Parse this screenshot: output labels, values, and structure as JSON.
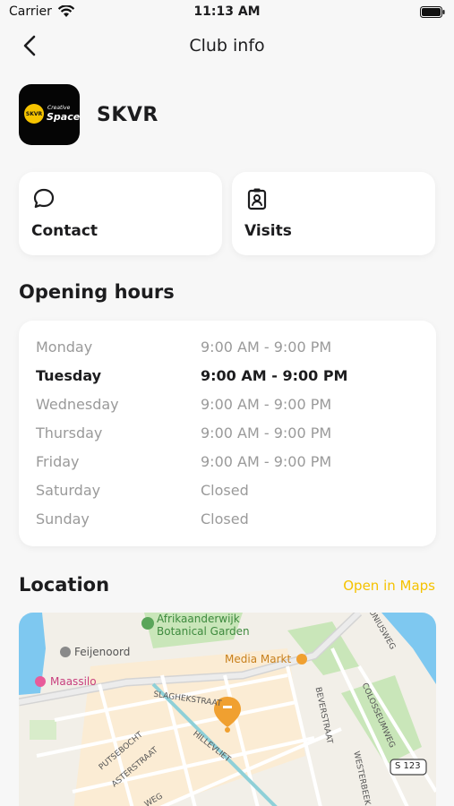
{
  "status": {
    "carrier": "Carrier",
    "time": "11:13 AM"
  },
  "nav": {
    "title": "Club info"
  },
  "club": {
    "name": "SKVR",
    "logo_badge": "SKVR",
    "logo_small": "Creative",
    "logo_word": "Space"
  },
  "actions": [
    {
      "label": "Contact",
      "icon": "chat-bubble-icon"
    },
    {
      "label": "Visits",
      "icon": "id-badge-icon"
    }
  ],
  "hours": {
    "title": "Opening hours",
    "rows": [
      {
        "day": "Monday",
        "time": "9:00 AM - 9:00 PM"
      },
      {
        "day": "Tuesday",
        "time": "9:00 AM - 9:00 PM"
      },
      {
        "day": "Wednesday",
        "time": "9:00 AM - 9:00 PM"
      },
      {
        "day": "Thursday",
        "time": "9:00 AM - 9:00 PM"
      },
      {
        "day": "Friday",
        "time": "9:00 AM - 9:00 PM"
      },
      {
        "day": "Saturday",
        "time": "Closed"
      },
      {
        "day": "Sunday",
        "time": "Closed"
      }
    ],
    "today": "Tuesday"
  },
  "location": {
    "title": "Location",
    "open_maps": "Open in Maps",
    "map_labels": {
      "garden_1": "Afrikaanderwijk",
      "garden_2": "Botanical Garden",
      "feijenoord": "Feijenoord",
      "media_markt": "Media Markt",
      "maassilo": "Maassilo",
      "slaghek": "SLAGHEKSTRAAT",
      "putsebocht": "PUTSEBOCHT",
      "asterstraat": "ASTERSTRAAT",
      "hillevliet": "HILLEVLIET",
      "beverstraat": "BEVERSTRAAT",
      "colosseumweg": "COLOSSEUMWEG",
      "westerbeek": "WESTERBEEK",
      "oniusweg": "ONIUSWEG",
      "route": "S 123",
      "weg": "WEG"
    }
  },
  "colors": {
    "accent": "#f5c200",
    "map_pin": "#f0a030"
  }
}
